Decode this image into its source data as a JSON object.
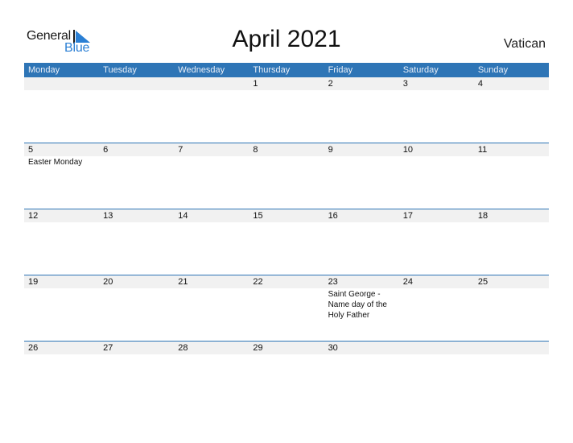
{
  "logo": {
    "line1": "General",
    "line2": "Blue"
  },
  "title": "April 2021",
  "country": "Vatican",
  "colors": {
    "header_bg": "#2e75b6",
    "logo_blue": "#2a7fd4",
    "day_row_bg": "#f1f1f1"
  },
  "weekdays": [
    "Monday",
    "Tuesday",
    "Wednesday",
    "Thursday",
    "Friday",
    "Saturday",
    "Sunday"
  ],
  "weeks": [
    {
      "days": [
        {
          "num": "",
          "holiday": ""
        },
        {
          "num": "",
          "holiday": ""
        },
        {
          "num": "",
          "holiday": ""
        },
        {
          "num": "1",
          "holiday": ""
        },
        {
          "num": "2",
          "holiday": ""
        },
        {
          "num": "3",
          "holiday": ""
        },
        {
          "num": "4",
          "holiday": ""
        }
      ]
    },
    {
      "days": [
        {
          "num": "5",
          "holiday": "Easter Monday"
        },
        {
          "num": "6",
          "holiday": ""
        },
        {
          "num": "7",
          "holiday": ""
        },
        {
          "num": "8",
          "holiday": ""
        },
        {
          "num": "9",
          "holiday": ""
        },
        {
          "num": "10",
          "holiday": ""
        },
        {
          "num": "11",
          "holiday": ""
        }
      ]
    },
    {
      "days": [
        {
          "num": "12",
          "holiday": ""
        },
        {
          "num": "13",
          "holiday": ""
        },
        {
          "num": "14",
          "holiday": ""
        },
        {
          "num": "15",
          "holiday": ""
        },
        {
          "num": "16",
          "holiday": ""
        },
        {
          "num": "17",
          "holiday": ""
        },
        {
          "num": "18",
          "holiday": ""
        }
      ]
    },
    {
      "days": [
        {
          "num": "19",
          "holiday": ""
        },
        {
          "num": "20",
          "holiday": ""
        },
        {
          "num": "21",
          "holiday": ""
        },
        {
          "num": "22",
          "holiday": ""
        },
        {
          "num": "23",
          "holiday": "Saint George - Name day of the Holy Father"
        },
        {
          "num": "24",
          "holiday": ""
        },
        {
          "num": "25",
          "holiday": ""
        }
      ]
    },
    {
      "days": [
        {
          "num": "26",
          "holiday": ""
        },
        {
          "num": "27",
          "holiday": ""
        },
        {
          "num": "28",
          "holiday": ""
        },
        {
          "num": "29",
          "holiday": ""
        },
        {
          "num": "30",
          "holiday": ""
        },
        {
          "num": "",
          "holiday": ""
        },
        {
          "num": "",
          "holiday": ""
        }
      ]
    }
  ]
}
